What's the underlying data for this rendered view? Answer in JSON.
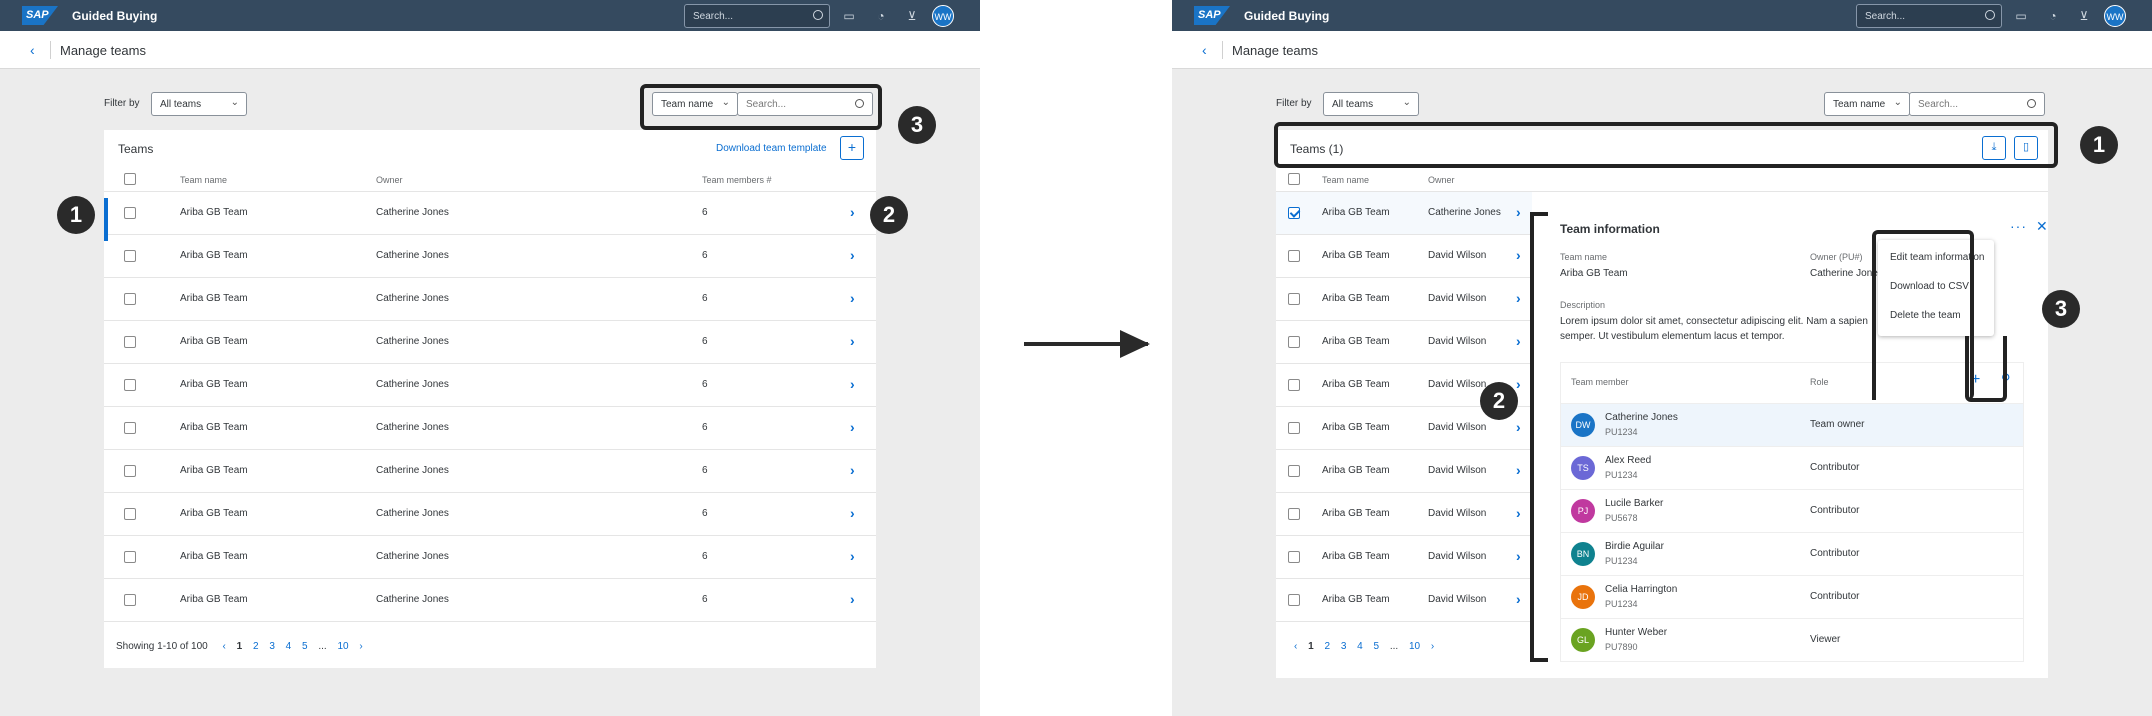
{
  "shell": {
    "brand": "SAP",
    "app_title": "Guided Buying",
    "search_placeholder": "Search...",
    "user_initials": "WW"
  },
  "page": {
    "title": "Manage teams"
  },
  "filter": {
    "label": "Filter by",
    "selected": "All teams",
    "search_field": "Team name",
    "search_placeholder": "Search..."
  },
  "left": {
    "table_title": "Teams",
    "download_link": "Download team template",
    "columns": [
      "Team name",
      "Owner",
      "Team members #"
    ],
    "rows": [
      {
        "team": "Ariba GB Team",
        "owner": "Catherine Jones",
        "members": "6"
      },
      {
        "team": "Ariba GB Team",
        "owner": "Catherine Jones",
        "members": "6"
      },
      {
        "team": "Ariba GB Team",
        "owner": "Catherine Jones",
        "members": "6"
      },
      {
        "team": "Ariba GB Team",
        "owner": "Catherine Jones",
        "members": "6"
      },
      {
        "team": "Ariba GB Team",
        "owner": "Catherine Jones",
        "members": "6"
      },
      {
        "team": "Ariba GB Team",
        "owner": "Catherine Jones",
        "members": "6"
      },
      {
        "team": "Ariba GB Team",
        "owner": "Catherine Jones",
        "members": "6"
      },
      {
        "team": "Ariba GB Team",
        "owner": "Catherine Jones",
        "members": "6"
      },
      {
        "team": "Ariba GB Team",
        "owner": "Catherine Jones",
        "members": "6"
      },
      {
        "team": "Ariba GB Team",
        "owner": "Catherine Jones",
        "members": "6"
      }
    ],
    "pagination": {
      "showing": "Showing 1-10 of 100",
      "pages": [
        "1",
        "2",
        "3",
        "4",
        "5",
        "...",
        "10"
      ]
    }
  },
  "right": {
    "table_title": "Teams (1)",
    "columns": [
      "Team name",
      "Owner"
    ],
    "rows": [
      {
        "team": "Ariba GB Team",
        "owner": "Catherine Jones"
      },
      {
        "team": "Ariba GB Team",
        "owner": "David Wilson"
      },
      {
        "team": "Ariba GB Team",
        "owner": "David Wilson"
      },
      {
        "team": "Ariba GB Team",
        "owner": "David Wilson"
      },
      {
        "team": "Ariba GB Team",
        "owner": "David Wilson"
      },
      {
        "team": "Ariba GB Team",
        "owner": "David Wilson"
      },
      {
        "team": "Ariba GB Team",
        "owner": "David Wilson"
      },
      {
        "team": "Ariba GB Team",
        "owner": "David Wilson"
      },
      {
        "team": "Ariba GB Team",
        "owner": "David Wilson"
      },
      {
        "team": "Ariba GB Team",
        "owner": "David Wilson"
      }
    ],
    "pagination": {
      "pages": [
        "1",
        "2",
        "3",
        "4",
        "5",
        "...",
        "10"
      ]
    },
    "detail": {
      "title": "Team information",
      "name_label": "Team name",
      "name_value": "Ariba GB Team",
      "owner_label": "Owner (PU#)",
      "owner_value": "Catherine Jones",
      "desc_label": "Description",
      "desc_line1": "Lorem ipsum dolor sit amet, consectetur adipiscing elit. Nam a sapien",
      "desc_line2": "semper. Ut vestibulum elementum lacus et tempor.",
      "member_col": "Team member",
      "role_col": "Role",
      "members": [
        {
          "initials": "DW",
          "name": "Catherine Jones",
          "id": "PU1234",
          "role": "Team owner",
          "color": "#1a74c6"
        },
        {
          "initials": "TS",
          "name": "Alex Reed",
          "id": "PU1234",
          "role": "Contributor",
          "color": "#6b68d6"
        },
        {
          "initials": "PJ",
          "name": "Lucile Barker",
          "id": "PU5678",
          "role": "Contributor",
          "color": "#c0399f"
        },
        {
          "initials": "BN",
          "name": "Birdie Aguilar",
          "id": "PU1234",
          "role": "Contributor",
          "color": "#0f828f"
        },
        {
          "initials": "JD",
          "name": "Celia Harrington",
          "id": "PU1234",
          "role": "Contributor",
          "color": "#e9730c"
        },
        {
          "initials": "GL",
          "name": "Hunter Weber",
          "id": "PU7890",
          "role": "Viewer",
          "color": "#6aa321"
        }
      ],
      "menu": [
        "Edit team information",
        "Download to CSV",
        "Delete the team"
      ]
    }
  },
  "callouts": {
    "one": "1",
    "two": "2",
    "three": "3"
  }
}
